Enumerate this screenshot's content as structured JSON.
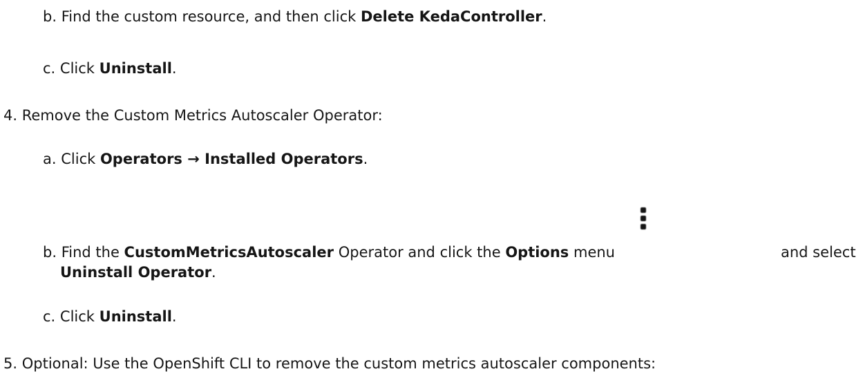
{
  "doc": {
    "sub_b": {
      "marker": "b.",
      "t1": "Find the custom resource, and then click ",
      "b1": "Delete KedaController",
      "t2": "."
    },
    "sub_c": {
      "marker": "c.",
      "t1": "Click ",
      "b1": "Uninstall",
      "t2": "."
    },
    "step4": {
      "marker": "4.",
      "text": "Remove the Custom Metrics Autoscaler Operator:",
      "a": {
        "marker": "a.",
        "t1": "Click ",
        "b1": "Operators → Installed Operators",
        "t2": "."
      },
      "b": {
        "marker": "b.",
        "t1": "Find the ",
        "b1": "CustomMetricsAutoscaler",
        "t2": " Operator and click the ",
        "b2": "Options",
        "t3": " menu",
        "t4": "and select",
        "b3": "Uninstall Operator",
        "t5": ".",
        "icon": "kebab-menu-icon"
      },
      "c": {
        "marker": "c.",
        "t1": "Click ",
        "b1": "Uninstall",
        "t2": "."
      }
    },
    "step5": {
      "marker": "5.",
      "text": "Optional: Use the OpenShift CLI to remove the custom metrics autoscaler components:"
    }
  }
}
